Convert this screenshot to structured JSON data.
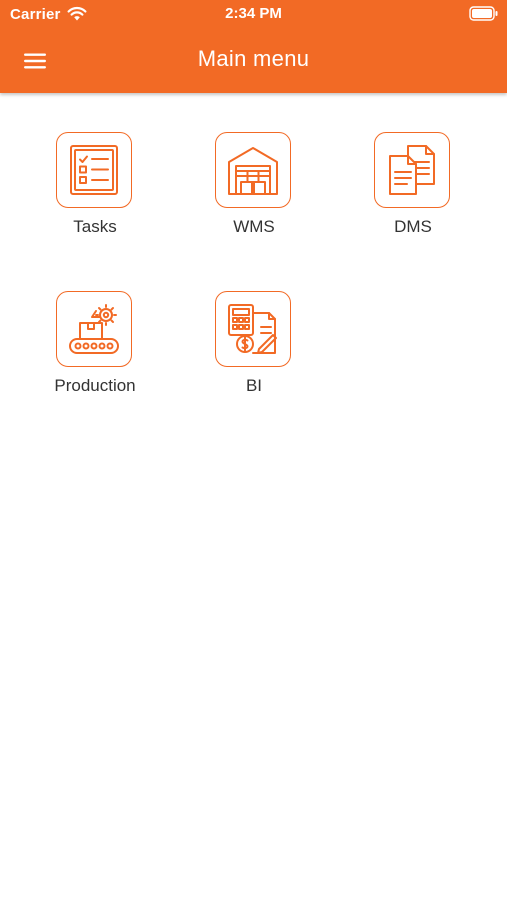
{
  "status_bar": {
    "carrier": "Carrier",
    "time": "2:34 PM"
  },
  "header": {
    "title": "Main menu"
  },
  "colors": {
    "accent": "#F26A25",
    "label": "#333333",
    "background": "#FFFFFF"
  },
  "menu": {
    "items": [
      {
        "label": "Tasks",
        "icon": "task-checklist-icon"
      },
      {
        "label": "WMS",
        "icon": "warehouse-icon"
      },
      {
        "label": "DMS",
        "icon": "documents-icon"
      },
      {
        "label": "Production",
        "icon": "conveyor-gear-icon"
      },
      {
        "label": "BI",
        "icon": "calculator-invoice-icon"
      }
    ]
  }
}
